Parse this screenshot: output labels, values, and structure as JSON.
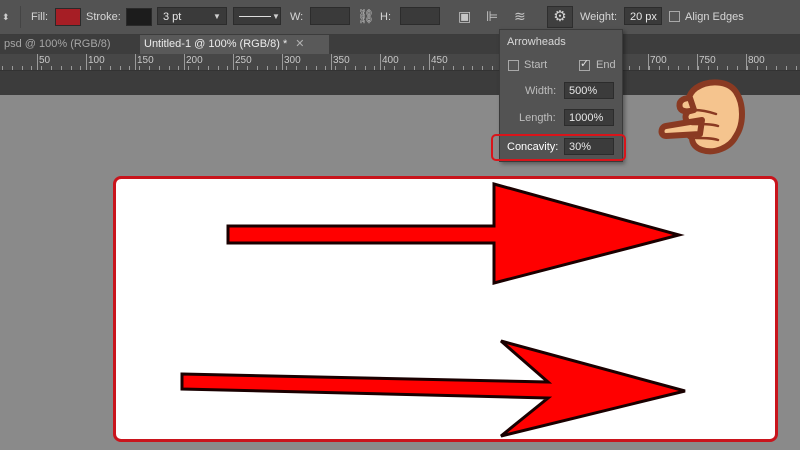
{
  "options_bar": {
    "fill_label": "Fill:",
    "fill_color": "#a61e25",
    "stroke_label": "Stroke:",
    "stroke_color": "#1c1c1c",
    "stroke_width": "3 pt",
    "w_label": "W:",
    "h_label": "H:",
    "weight_label": "Weight:",
    "weight_value": "20 px",
    "align_edges_label": "Align Edges"
  },
  "tabs": [
    {
      "label": "psd @ 100% (RGB/8) *",
      "active": false
    },
    {
      "label": "Untitled-1 @ 100% (RGB/8) *",
      "active": true
    }
  ],
  "ruler": {
    "labels": [
      "50",
      "100",
      "150",
      "200",
      "250",
      "300",
      "350",
      "400",
      "450",
      "700",
      "750",
      "800"
    ]
  },
  "arrowheads_popup": {
    "title": "Arrowheads",
    "start_label": "Start",
    "start_checked": false,
    "end_label": "End",
    "end_checked": true,
    "width_label": "Width:",
    "width_value": "500%",
    "length_label": "Length:",
    "length_value": "1000%",
    "concavity_label": "Concavity:",
    "concavity_value": "30%"
  },
  "colors": {
    "highlight": "#d9141a",
    "arrow_fill": "#ff0000",
    "arrow_stroke": "#1a0000",
    "hand_skin": "#f5c48e",
    "hand_outline": "#8a3a22"
  },
  "icons": [
    "close-icon",
    "link-icon",
    "path-operations-icon",
    "path-alignment-icon",
    "path-arrangement-icon",
    "gear-icon",
    "checkmark-icon",
    "pointing-hand-icon"
  ]
}
